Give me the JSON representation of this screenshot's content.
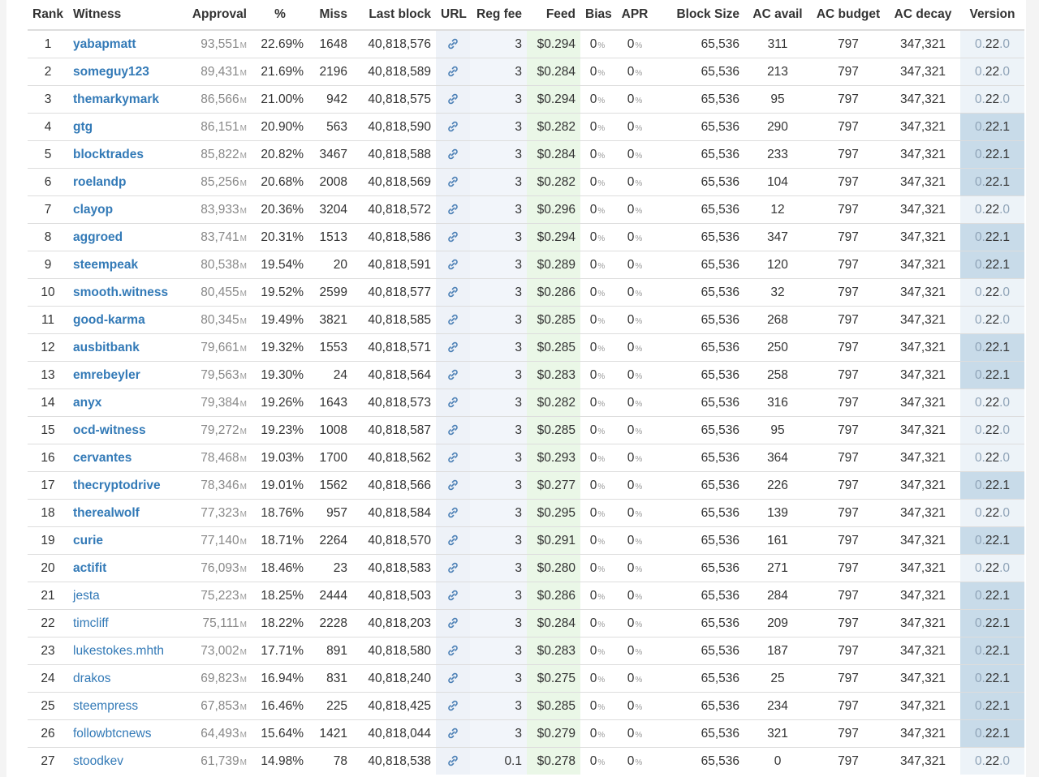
{
  "columns": {
    "rank": "Rank",
    "witness": "Witness",
    "approval": "Approval",
    "percent": "%",
    "miss": "Miss",
    "last_block": "Last block",
    "url": "URL",
    "reg_fee": "Reg fee",
    "feed": "Feed",
    "bias": "Bias",
    "apr": "APR",
    "block_size": "Block Size",
    "ac_avail": "AC avail",
    "ac_budget": "AC budget",
    "ac_decay": "AC decay",
    "version": "Version"
  },
  "units": {
    "approval": "M",
    "percent": "%",
    "bias": "0",
    "apr": "0"
  },
  "icons": {
    "url": "link-icon"
  },
  "colors": {
    "link": "#337ab7",
    "feed_bg": "#eaf7e7",
    "url_bg": "#eef2f8",
    "version_new_bg": "#c8dbe9"
  },
  "rows": [
    {
      "rank": "1",
      "witness": "yabapmatt",
      "bold": true,
      "approval": "93,551",
      "pct": "22.69%",
      "miss": "1648",
      "last_block": "40,818,576",
      "reg_fee": "3",
      "feed": "$0.294",
      "bias": "0",
      "apr": "0",
      "block_size": "65,536",
      "ac_avail": "311",
      "ac_budget": "797",
      "ac_decay": "347,321",
      "version": {
        "major": "0.",
        "mid": "22",
        "minor": ".0"
      }
    },
    {
      "rank": "2",
      "witness": "someguy123",
      "bold": true,
      "approval": "89,431",
      "pct": "21.69%",
      "miss": "2196",
      "last_block": "40,818,589",
      "reg_fee": "3",
      "feed": "$0.284",
      "bias": "0",
      "apr": "0",
      "block_size": "65,536",
      "ac_avail": "213",
      "ac_budget": "797",
      "ac_decay": "347,321",
      "version": {
        "major": "0.",
        "mid": "22",
        "minor": ".0"
      }
    },
    {
      "rank": "3",
      "witness": "themarkymark",
      "bold": true,
      "approval": "86,566",
      "pct": "21.00%",
      "miss": "942",
      "last_block": "40,818,575",
      "reg_fee": "3",
      "feed": "$0.294",
      "bias": "0",
      "apr": "0",
      "block_size": "65,536",
      "ac_avail": "95",
      "ac_budget": "797",
      "ac_decay": "347,321",
      "version": {
        "major": "0.",
        "mid": "22",
        "minor": ".0"
      }
    },
    {
      "rank": "4",
      "witness": "gtg",
      "bold": true,
      "approval": "86,151",
      "pct": "20.90%",
      "miss": "563",
      "last_block": "40,818,590",
      "reg_fee": "3",
      "feed": "$0.282",
      "bias": "0",
      "apr": "0",
      "block_size": "65,536",
      "ac_avail": "290",
      "ac_budget": "797",
      "ac_decay": "347,321",
      "version": {
        "major": "0.",
        "mid": "22",
        "minor": ".1"
      }
    },
    {
      "rank": "5",
      "witness": "blocktrades",
      "bold": true,
      "approval": "85,822",
      "pct": "20.82%",
      "miss": "3467",
      "last_block": "40,818,588",
      "reg_fee": "3",
      "feed": "$0.284",
      "bias": "0",
      "apr": "0",
      "block_size": "65,536",
      "ac_avail": "233",
      "ac_budget": "797",
      "ac_decay": "347,321",
      "version": {
        "major": "0.",
        "mid": "22",
        "minor": ".1"
      }
    },
    {
      "rank": "6",
      "witness": "roelandp",
      "bold": true,
      "approval": "85,256",
      "pct": "20.68%",
      "miss": "2008",
      "last_block": "40,818,569",
      "reg_fee": "3",
      "feed": "$0.282",
      "bias": "0",
      "apr": "0",
      "block_size": "65,536",
      "ac_avail": "104",
      "ac_budget": "797",
      "ac_decay": "347,321",
      "version": {
        "major": "0.",
        "mid": "22",
        "minor": ".1"
      }
    },
    {
      "rank": "7",
      "witness": "clayop",
      "bold": true,
      "approval": "83,933",
      "pct": "20.36%",
      "miss": "3204",
      "last_block": "40,818,572",
      "reg_fee": "3",
      "feed": "$0.296",
      "bias": "0",
      "apr": "0",
      "block_size": "65,536",
      "ac_avail": "12",
      "ac_budget": "797",
      "ac_decay": "347,321",
      "version": {
        "major": "0.",
        "mid": "22",
        "minor": ".0"
      }
    },
    {
      "rank": "8",
      "witness": "aggroed",
      "bold": true,
      "approval": "83,741",
      "pct": "20.31%",
      "miss": "1513",
      "last_block": "40,818,586",
      "reg_fee": "3",
      "feed": "$0.294",
      "bias": "0",
      "apr": "0",
      "block_size": "65,536",
      "ac_avail": "347",
      "ac_budget": "797",
      "ac_decay": "347,321",
      "version": {
        "major": "0.",
        "mid": "22",
        "minor": ".1"
      }
    },
    {
      "rank": "9",
      "witness": "steempeak",
      "bold": true,
      "approval": "80,538",
      "pct": "19.54%",
      "miss": "20",
      "last_block": "40,818,591",
      "reg_fee": "3",
      "feed": "$0.289",
      "bias": "0",
      "apr": "0",
      "block_size": "65,536",
      "ac_avail": "120",
      "ac_budget": "797",
      "ac_decay": "347,321",
      "version": {
        "major": "0.",
        "mid": "22",
        "minor": ".1"
      }
    },
    {
      "rank": "10",
      "witness": "smooth.witness",
      "bold": true,
      "approval": "80,455",
      "pct": "19.52%",
      "miss": "2599",
      "last_block": "40,818,577",
      "reg_fee": "3",
      "feed": "$0.286",
      "bias": "0",
      "apr": "0",
      "block_size": "65,536",
      "ac_avail": "32",
      "ac_budget": "797",
      "ac_decay": "347,321",
      "version": {
        "major": "0.",
        "mid": "22",
        "minor": ".0"
      }
    },
    {
      "rank": "11",
      "witness": "good-karma",
      "bold": true,
      "approval": "80,345",
      "pct": "19.49%",
      "miss": "3821",
      "last_block": "40,818,585",
      "reg_fee": "3",
      "feed": "$0.285",
      "bias": "0",
      "apr": "0",
      "block_size": "65,536",
      "ac_avail": "268",
      "ac_budget": "797",
      "ac_decay": "347,321",
      "version": {
        "major": "0.",
        "mid": "22",
        "minor": ".0"
      }
    },
    {
      "rank": "12",
      "witness": "ausbitbank",
      "bold": true,
      "approval": "79,661",
      "pct": "19.32%",
      "miss": "1553",
      "last_block": "40,818,571",
      "reg_fee": "3",
      "feed": "$0.285",
      "bias": "0",
      "apr": "0",
      "block_size": "65,536",
      "ac_avail": "250",
      "ac_budget": "797",
      "ac_decay": "347,321",
      "version": {
        "major": "0.",
        "mid": "22",
        "minor": ".1"
      }
    },
    {
      "rank": "13",
      "witness": "emrebeyler",
      "bold": true,
      "approval": "79,563",
      "pct": "19.30%",
      "miss": "24",
      "last_block": "40,818,564",
      "reg_fee": "3",
      "feed": "$0.283",
      "bias": "0",
      "apr": "0",
      "block_size": "65,536",
      "ac_avail": "258",
      "ac_budget": "797",
      "ac_decay": "347,321",
      "version": {
        "major": "0.",
        "mid": "22",
        "minor": ".1"
      }
    },
    {
      "rank": "14",
      "witness": "anyx",
      "bold": true,
      "approval": "79,384",
      "pct": "19.26%",
      "miss": "1643",
      "last_block": "40,818,573",
      "reg_fee": "3",
      "feed": "$0.282",
      "bias": "0",
      "apr": "0",
      "block_size": "65,536",
      "ac_avail": "316",
      "ac_budget": "797",
      "ac_decay": "347,321",
      "version": {
        "major": "0.",
        "mid": "22",
        "minor": ".0"
      }
    },
    {
      "rank": "15",
      "witness": "ocd-witness",
      "bold": true,
      "approval": "79,272",
      "pct": "19.23%",
      "miss": "1008",
      "last_block": "40,818,587",
      "reg_fee": "3",
      "feed": "$0.285",
      "bias": "0",
      "apr": "0",
      "block_size": "65,536",
      "ac_avail": "95",
      "ac_budget": "797",
      "ac_decay": "347,321",
      "version": {
        "major": "0.",
        "mid": "22",
        "minor": ".0"
      }
    },
    {
      "rank": "16",
      "witness": "cervantes",
      "bold": true,
      "approval": "78,468",
      "pct": "19.03%",
      "miss": "1700",
      "last_block": "40,818,562",
      "reg_fee": "3",
      "feed": "$0.293",
      "bias": "0",
      "apr": "0",
      "block_size": "65,536",
      "ac_avail": "364",
      "ac_budget": "797",
      "ac_decay": "347,321",
      "version": {
        "major": "0.",
        "mid": "22",
        "minor": ".0"
      }
    },
    {
      "rank": "17",
      "witness": "thecryptodrive",
      "bold": true,
      "approval": "78,346",
      "pct": "19.01%",
      "miss": "1562",
      "last_block": "40,818,566",
      "reg_fee": "3",
      "feed": "$0.277",
      "bias": "0",
      "apr": "0",
      "block_size": "65,536",
      "ac_avail": "226",
      "ac_budget": "797",
      "ac_decay": "347,321",
      "version": {
        "major": "0.",
        "mid": "22",
        "minor": ".1"
      }
    },
    {
      "rank": "18",
      "witness": "therealwolf",
      "bold": true,
      "approval": "77,323",
      "pct": "18.76%",
      "miss": "957",
      "last_block": "40,818,584",
      "reg_fee": "3",
      "feed": "$0.295",
      "bias": "0",
      "apr": "0",
      "block_size": "65,536",
      "ac_avail": "139",
      "ac_budget": "797",
      "ac_decay": "347,321",
      "version": {
        "major": "0.",
        "mid": "22",
        "minor": ".0"
      }
    },
    {
      "rank": "19",
      "witness": "curie",
      "bold": true,
      "approval": "77,140",
      "pct": "18.71%",
      "miss": "2264",
      "last_block": "40,818,570",
      "reg_fee": "3",
      "feed": "$0.291",
      "bias": "0",
      "apr": "0",
      "block_size": "65,536",
      "ac_avail": "161",
      "ac_budget": "797",
      "ac_decay": "347,321",
      "version": {
        "major": "0.",
        "mid": "22",
        "minor": ".1"
      }
    },
    {
      "rank": "20",
      "witness": "actifit",
      "bold": true,
      "approval": "76,093",
      "pct": "18.46%",
      "miss": "23",
      "last_block": "40,818,583",
      "reg_fee": "3",
      "feed": "$0.280",
      "bias": "0",
      "apr": "0",
      "block_size": "65,536",
      "ac_avail": "271",
      "ac_budget": "797",
      "ac_decay": "347,321",
      "version": {
        "major": "0.",
        "mid": "22",
        "minor": ".0"
      }
    },
    {
      "rank": "21",
      "witness": "jesta",
      "bold": false,
      "approval": "75,223",
      "pct": "18.25%",
      "miss": "2444",
      "last_block": "40,818,503",
      "reg_fee": "3",
      "feed": "$0.286",
      "bias": "0",
      "apr": "0",
      "block_size": "65,536",
      "ac_avail": "284",
      "ac_budget": "797",
      "ac_decay": "347,321",
      "version": {
        "major": "0.",
        "mid": "22",
        "minor": ".1"
      }
    },
    {
      "rank": "22",
      "witness": "timcliff",
      "bold": false,
      "approval": "75,111",
      "pct": "18.22%",
      "miss": "2228",
      "last_block": "40,818,203",
      "reg_fee": "3",
      "feed": "$0.284",
      "bias": "0",
      "apr": "0",
      "block_size": "65,536",
      "ac_avail": "209",
      "ac_budget": "797",
      "ac_decay": "347,321",
      "version": {
        "major": "0.",
        "mid": "22",
        "minor": ".1"
      }
    },
    {
      "rank": "23",
      "witness": "lukestokes.mhth",
      "bold": false,
      "approval": "73,002",
      "pct": "17.71%",
      "miss": "891",
      "last_block": "40,818,580",
      "reg_fee": "3",
      "feed": "$0.283",
      "bias": "0",
      "apr": "0",
      "block_size": "65,536",
      "ac_avail": "187",
      "ac_budget": "797",
      "ac_decay": "347,321",
      "version": {
        "major": "0.",
        "mid": "22",
        "minor": ".1"
      }
    },
    {
      "rank": "24",
      "witness": "drakos",
      "bold": false,
      "approval": "69,823",
      "pct": "16.94%",
      "miss": "831",
      "last_block": "40,818,240",
      "reg_fee": "3",
      "feed": "$0.275",
      "bias": "0",
      "apr": "0",
      "block_size": "65,536",
      "ac_avail": "25",
      "ac_budget": "797",
      "ac_decay": "347,321",
      "version": {
        "major": "0.",
        "mid": "22",
        "minor": ".1"
      }
    },
    {
      "rank": "25",
      "witness": "steempress",
      "bold": false,
      "approval": "67,853",
      "pct": "16.46%",
      "miss": "225",
      "last_block": "40,818,425",
      "reg_fee": "3",
      "feed": "$0.285",
      "bias": "0",
      "apr": "0",
      "block_size": "65,536",
      "ac_avail": "234",
      "ac_budget": "797",
      "ac_decay": "347,321",
      "version": {
        "major": "0.",
        "mid": "22",
        "minor": ".1"
      }
    },
    {
      "rank": "26",
      "witness": "followbtcnews",
      "bold": false,
      "approval": "64,493",
      "pct": "15.64%",
      "miss": "1421",
      "last_block": "40,818,044",
      "reg_fee": "3",
      "feed": "$0.279",
      "bias": "0",
      "apr": "0",
      "block_size": "65,536",
      "ac_avail": "321",
      "ac_budget": "797",
      "ac_decay": "347,321",
      "version": {
        "major": "0.",
        "mid": "22",
        "minor": ".1"
      }
    },
    {
      "rank": "27",
      "witness": "stoodkev",
      "bold": false,
      "approval": "61,739",
      "pct": "14.98%",
      "miss": "78",
      "last_block": "40,818,538",
      "reg_fee": "0.1",
      "feed": "$0.278",
      "bias": "0",
      "apr": "0",
      "block_size": "65,536",
      "ac_avail": "0",
      "ac_budget": "797",
      "ac_decay": "347,321",
      "version": {
        "major": "0.",
        "mid": "22",
        "minor": ".0"
      }
    }
  ]
}
